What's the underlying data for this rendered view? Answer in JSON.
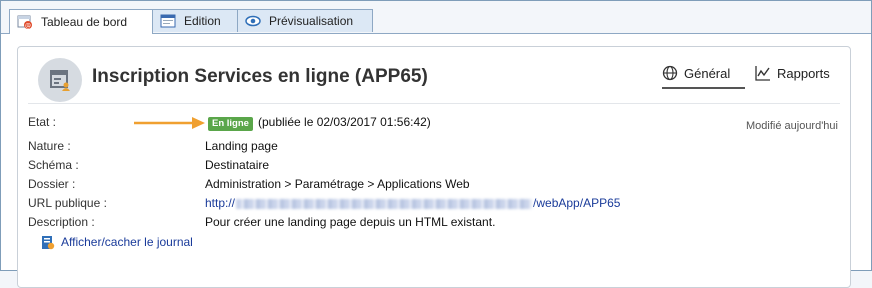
{
  "tabs": [
    {
      "label": "Tableau de bord",
      "icon": "dashboard-icon"
    },
    {
      "label": "Edition",
      "icon": "edit-window-icon"
    },
    {
      "label": "Prévisualisation",
      "icon": "eye-icon"
    }
  ],
  "header": {
    "title": "Inscription Services en ligne (APP65)",
    "views": [
      {
        "label": "Général",
        "icon": "globe-icon"
      },
      {
        "label": "Rapports",
        "icon": "line-chart-icon"
      }
    ]
  },
  "details": {
    "modified": "Modifié aujourd'hui",
    "etat_label": "Etat :",
    "status_badge": "En ligne",
    "published": "(publiée le   02/03/2017 01:56:42)",
    "rows": [
      {
        "label": "Nature :",
        "value": "Landing page"
      },
      {
        "label": "Schéma :",
        "value": "Destinataire"
      },
      {
        "label": "Dossier :",
        "value": "Administration > Paramétrage > Applications Web"
      }
    ],
    "url_label": "URL publique :",
    "url_prefix": "http://",
    "url_suffix": "/webApp/APP65",
    "description_label": "Description :",
    "description_value": "Pour créer une landing page depuis un HTML existant."
  },
  "journal_link": "Afficher/cacher le journal",
  "colors": {
    "badge": "#5aa64a",
    "arrow": "#f0a030",
    "link": "#1a3b9a",
    "tab_inactive": "#dce8f5"
  }
}
